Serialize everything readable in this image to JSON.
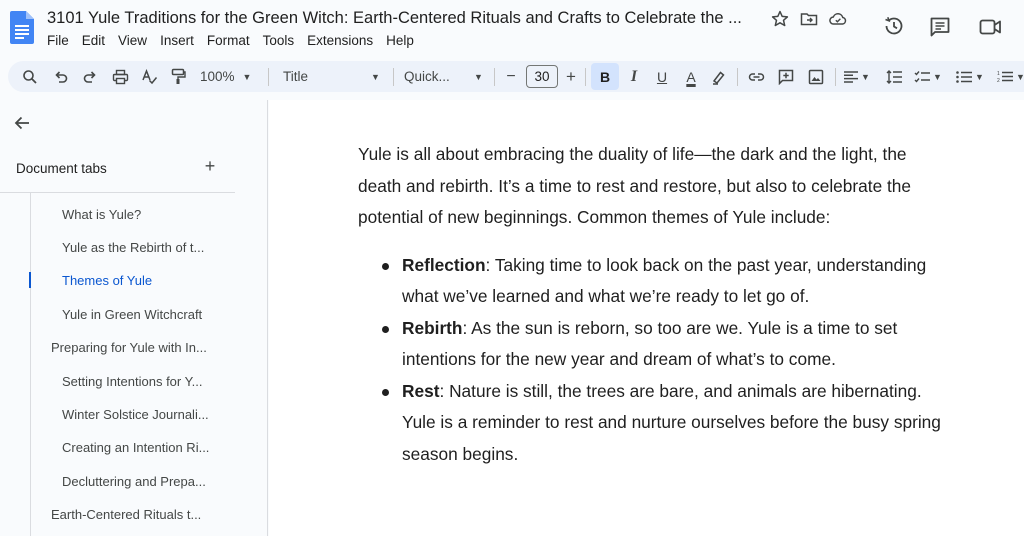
{
  "app": {
    "title": "3101 Yule Traditions for the Green Witch: Earth-Centered Rituals and Crafts to Celebrate the ...",
    "menu": [
      "File",
      "Edit",
      "View",
      "Insert",
      "Format",
      "Tools",
      "Extensions",
      "Help"
    ]
  },
  "toolbar": {
    "zoom": "100%",
    "style": "Title",
    "font": "Quick...",
    "font_size": "30",
    "minus": "−",
    "plus": "+",
    "bold": "B",
    "italic": "I",
    "underline": "U",
    "text_color": "A"
  },
  "sidebar": {
    "header": "Document tabs",
    "add": "+",
    "items": [
      {
        "label": "What is Yule?",
        "level": 2
      },
      {
        "label": "Yule as the Rebirth of t...",
        "level": 2
      },
      {
        "label": "Themes of Yule",
        "level": 2,
        "active": true
      },
      {
        "label": "Yule in Green Witchcraft",
        "level": 2
      },
      {
        "label": "Preparing for Yule with In...",
        "level": 1
      },
      {
        "label": "Setting Intentions for Y...",
        "level": 2
      },
      {
        "label": "Winter Solstice Journali...",
        "level": 2
      },
      {
        "label": "Creating an Intention Ri...",
        "level": 2
      },
      {
        "label": "Decluttering and Prepa...",
        "level": 2
      },
      {
        "label": "Earth-Centered Rituals t...",
        "level": 1
      }
    ]
  },
  "document": {
    "intro": "Yule is all about embracing the duality of life—the dark and the light, the death and rebirth. It’s a time to rest and restore, but also to celebrate the potential of new beginnings. Common themes of Yule include:",
    "bullets": [
      {
        "term": "Reflection",
        "text": ": Taking time to look back on the past year, understanding what we’ve learned and what we’re ready to let go of."
      },
      {
        "term": "Rebirth",
        "text": ": As the sun is reborn, so too are we. Yule is a time to set intentions for the new year and dream of what’s to come."
      },
      {
        "term": "Rest",
        "text": ": Nature is still, the trees are bare, and animals are hibernating. Yule is a reminder to rest and nurture ourselves before the busy spring season begins."
      }
    ]
  },
  "colors": {
    "accent": "#0b57d0",
    "toolbar_bg": "#edf2fa",
    "active_button_bg": "#d3e3fd",
    "docs_logo": "#4285f4"
  }
}
